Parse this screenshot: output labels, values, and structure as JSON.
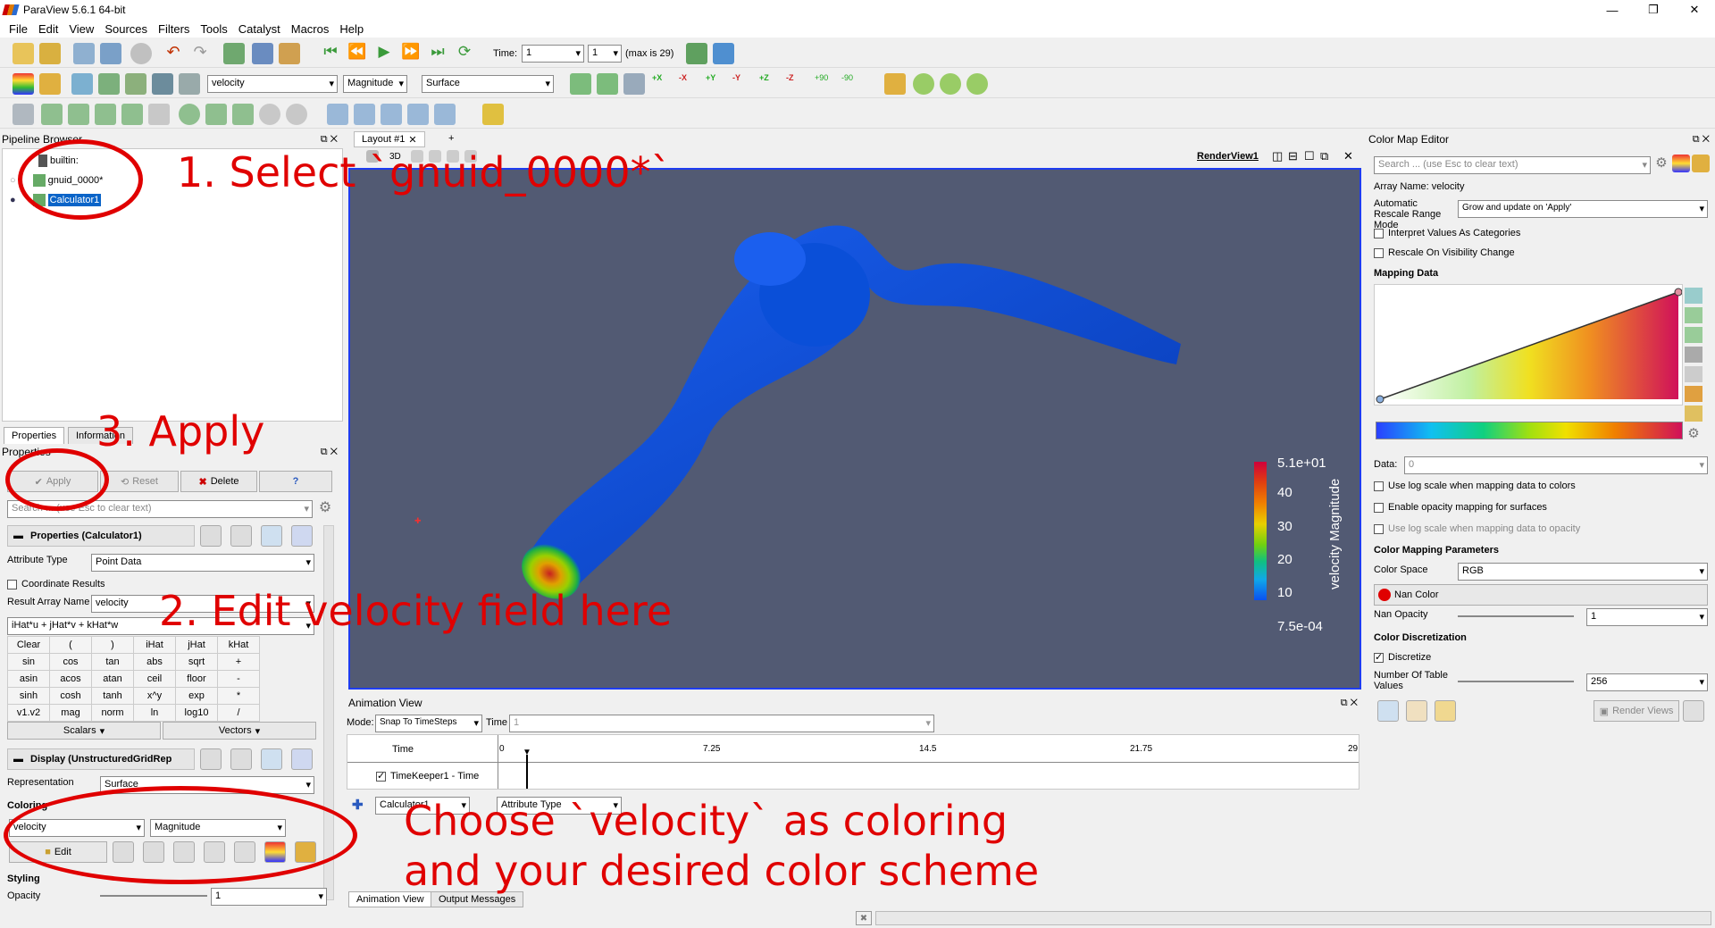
{
  "app": {
    "title": "ParaView 5.6.1 64-bit",
    "win_controls": [
      "—",
      "❐",
      "✕"
    ]
  },
  "menu": [
    "File",
    "Edit",
    "View",
    "Sources",
    "Filters",
    "Tools",
    "Catalyst",
    "Macros",
    "Help"
  ],
  "time_toolbar": {
    "time_label": "Time:",
    "time_value": "1",
    "index_value": "1",
    "max_label": "(max is 29)"
  },
  "color_toolbar": {
    "array": "velocity",
    "component": "Magnitude",
    "representation": "Surface"
  },
  "camera_labels": [
    "+X",
    "-X",
    "+Y",
    "-Y",
    "+Z",
    "-Z",
    "+90",
    "-90"
  ],
  "pipeline": {
    "title": "Pipeline Browser",
    "items": [
      {
        "label": "builtin:"
      },
      {
        "label": "gnuid_0000*"
      },
      {
        "label": "Calculator1"
      }
    ]
  },
  "layout": {
    "tab": "Layout #1",
    "add": "+",
    "view_mode": "3D",
    "view_name": "RenderView1"
  },
  "props": {
    "tabs": [
      "Properties",
      "Information"
    ],
    "title": "Properties",
    "apply": "Apply",
    "reset": "Reset",
    "delete": "Delete",
    "help": "?",
    "search_placeholder": "Search ... (use Esc to clear text)",
    "section_calc": "Properties (Calculator1)",
    "attribute_type_label": "Attribute Type",
    "attribute_type": "Point Data",
    "coord_results": "Coordinate Results",
    "result_name_label": "Result Array Name",
    "result_name": "velocity",
    "expression": "iHat*u + jHat*v + kHat*w",
    "calc_buttons": [
      "Clear",
      "(",
      ")",
      "iHat",
      "jHat",
      "kHat",
      "sin",
      "cos",
      "tan",
      "abs",
      "sqrt",
      "+",
      "asin",
      "acos",
      "atan",
      "ceil",
      "floor",
      "-",
      "sinh",
      "cosh",
      "tanh",
      "x^y",
      "exp",
      "*",
      "v1.v2",
      "mag",
      "norm",
      "ln",
      "log10",
      "/"
    ],
    "scalars": "Scalars",
    "vectors": "Vectors",
    "section_display": "Display (UnstructuredGridRep",
    "representation_label": "Representation",
    "representation": "Surface",
    "coloring_label": "Coloring",
    "coloring_array": "velocity",
    "coloring_component": "Magnitude",
    "edit": "Edit",
    "styling_label": "Styling",
    "opacity_label": "Opacity",
    "opacity_value": "1"
  },
  "render": {
    "legend_title": "velocity Magnitude",
    "legend_ticks": [
      "5.1e+01",
      "40",
      "30",
      "20",
      "10",
      "7.5e-04"
    ],
    "background": "#525a73"
  },
  "animation": {
    "title": "Animation View",
    "mode_label": "Mode:",
    "mode": "Snap To TimeSteps",
    "time_label": "Time",
    "time_value": "1",
    "col_time": "Time",
    "ticks": [
      "0",
      "7.25",
      "14.5",
      "21.75",
      "29"
    ],
    "track": "TimeKeeper1 - Time",
    "source_combo": "Calculator1",
    "attr_combo": "Attribute Type",
    "bottom_tabs": [
      "Animation View",
      "Output Messages"
    ]
  },
  "cme": {
    "title": "Color Map Editor",
    "search_placeholder": "Search ... (use Esc to clear text)",
    "array_name": "Array Name: velocity",
    "auto_rescale_label": "Automatic Rescale Range Mode",
    "auto_rescale": "Grow and update on 'Apply'",
    "interpret_categories": "Interpret Values As Categories",
    "rescale_visibility": "Rescale On Visibility Change",
    "mapping_data": "Mapping Data",
    "data_label": "Data:",
    "data_value": "0",
    "log_scale": "Use log scale when mapping data to colors",
    "opacity_mapping": "Enable opacity mapping for surfaces",
    "log_opacity": "Use log scale when mapping data to opacity",
    "params_title": "Color Mapping Parameters",
    "color_space_label": "Color Space",
    "color_space": "RGB",
    "nan_color": "Nan Color",
    "nan_opacity_label": "Nan Opacity",
    "nan_opacity": "1",
    "discretization_title": "Color Discretization",
    "discretize": "Discretize",
    "table_values_label": "Number Of Table Values",
    "table_values": "256",
    "render_views": "Render Views"
  },
  "annotations": {
    "step1": "1. Select `gnuid_0000*`",
    "step2": "2.  Edit velocity field here",
    "step3": "3. Apply",
    "step4a": "Choose `velocity` as coloring",
    "step4b": "and your desired color scheme"
  },
  "colors": {
    "accent": "#0a64c8",
    "annotation": "#e00000",
    "mesh": "#0a4fd8"
  }
}
